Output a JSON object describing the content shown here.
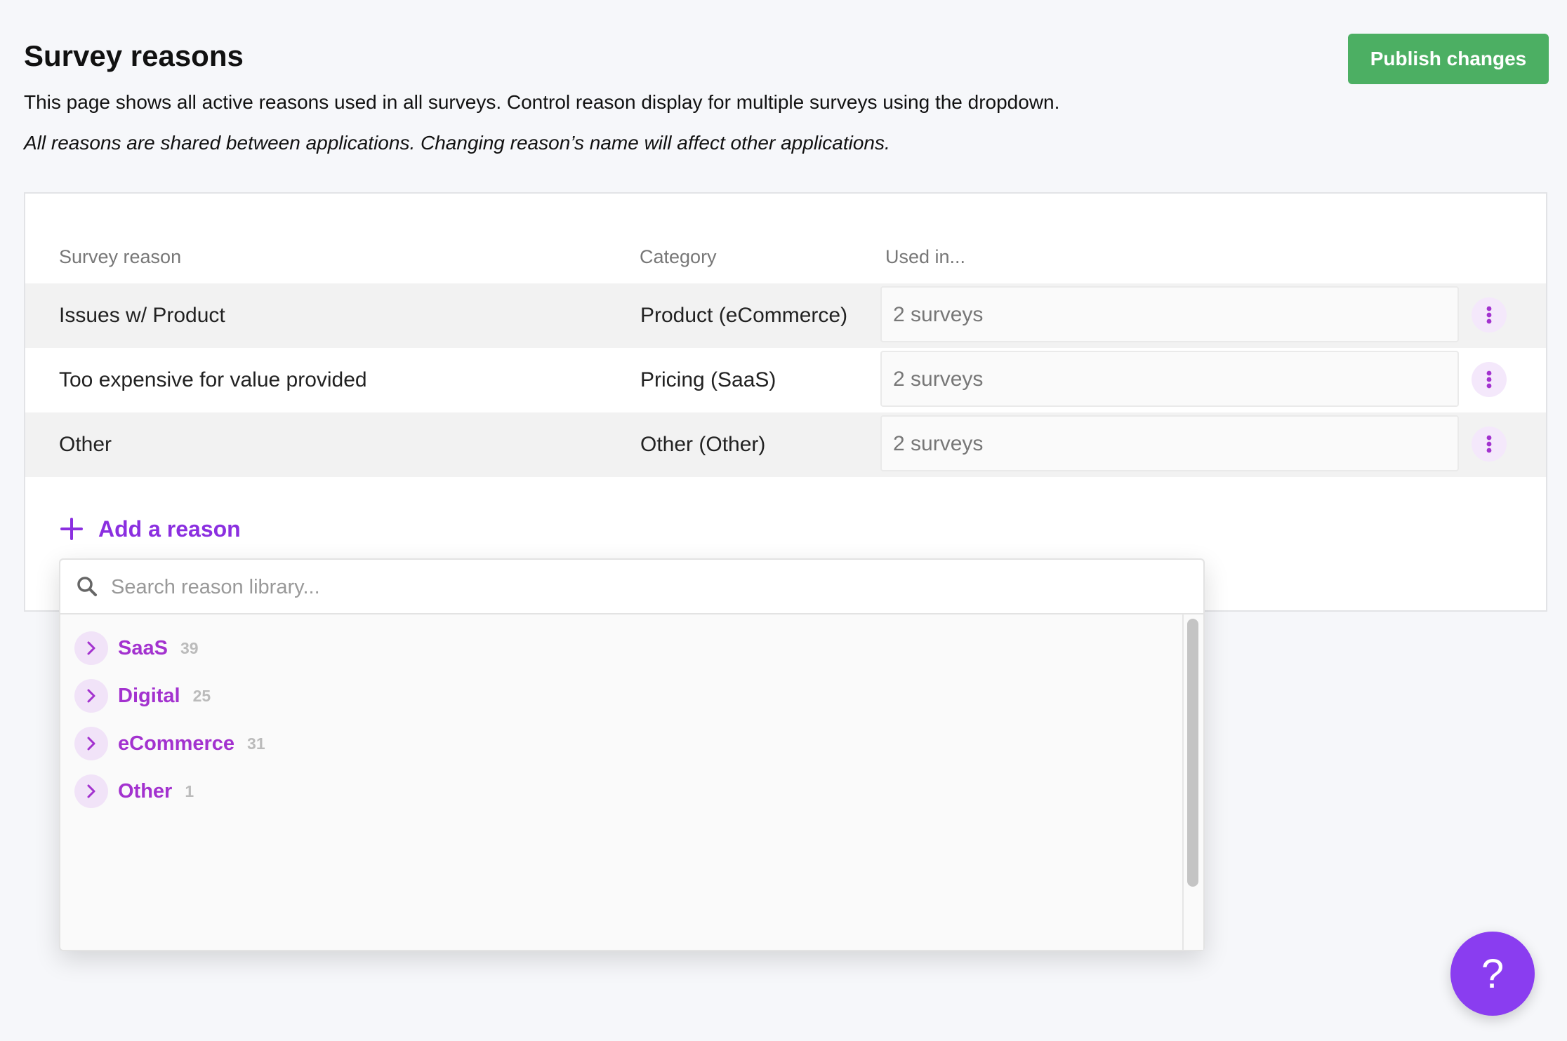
{
  "header": {
    "title": "Survey reasons",
    "publish_label": "Publish changes",
    "description": "This page shows all active reasons used in all surveys. Control reason display for multiple surveys using the dropdown.",
    "note": "All reasons are shared between applications. Changing reason’s name will affect other applications."
  },
  "table": {
    "columns": [
      "Survey reason",
      "Category",
      "Used in..."
    ],
    "rows": [
      {
        "reason": "Issues w/ Product",
        "category": "Product (eCommerce)",
        "used_in": "2 surveys"
      },
      {
        "reason": "Too expensive for value provided",
        "category": "Pricing (SaaS)",
        "used_in": "2 surveys"
      },
      {
        "reason": "Other",
        "category": "Other (Other)",
        "used_in": "2 surveys"
      }
    ]
  },
  "add_reason": {
    "label": "Add a reason"
  },
  "library": {
    "search_placeholder": "Search reason library...",
    "categories": [
      {
        "name": "SaaS",
        "count": "39"
      },
      {
        "name": "Digital",
        "count": "25"
      },
      {
        "name": "eCommerce",
        "count": "31"
      },
      {
        "name": "Other",
        "count": "1"
      }
    ]
  },
  "help": {
    "label": "?"
  },
  "colors": {
    "accent": "#8b2fe0",
    "category_text": "#a332cf",
    "publish": "#4caf63",
    "help": "#8a3df0"
  },
  "icons": {
    "add": "plus-icon",
    "search": "search-icon",
    "expand": "chevron-right-icon",
    "row_menu": "kebab-menu-icon"
  }
}
